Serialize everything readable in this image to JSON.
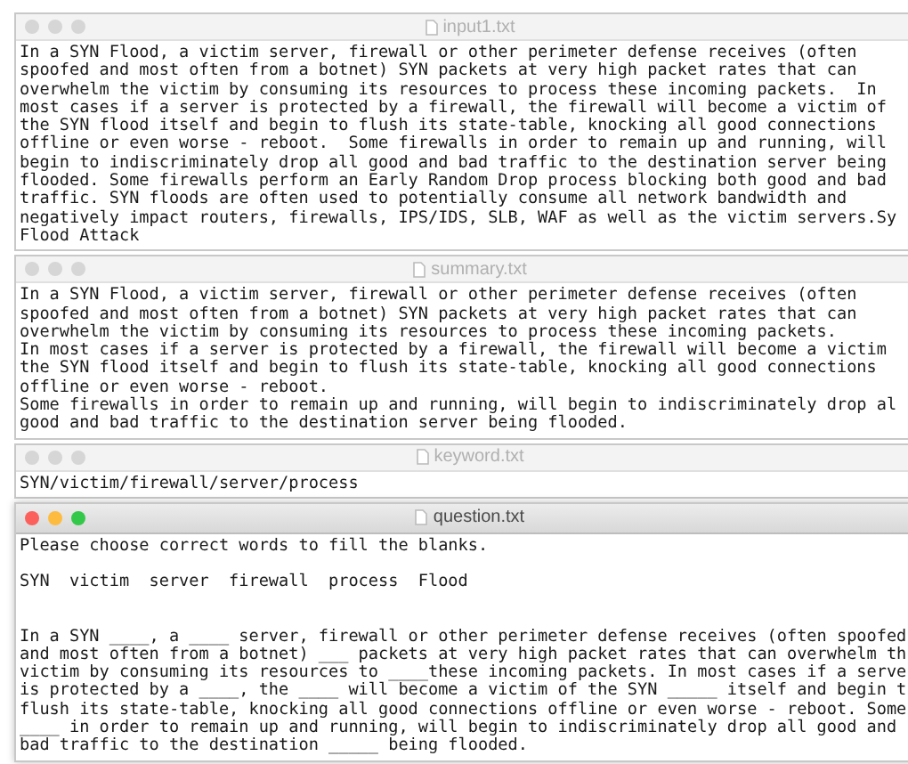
{
  "windows": [
    {
      "title": "input1.txt",
      "active": false,
      "blocks": [
        {
          "kind": "text",
          "lines": [
            "In a SYN Flood, a victim server, firewall or other perimeter defense receives (often",
            "spoofed and most often from a botnet) SYN packets at very high packet rates that can",
            "overwhelm the victim by consuming its resources to process these incoming packets.  In",
            "most cases if a server is protected by a firewall, the firewall will become a victim of",
            "the SYN flood itself and begin to flush its state-table, knocking all good connections",
            "offline or even worse - reboot.  Some firewalls in order to remain up and running, will",
            "begin to indiscriminately drop all good and bad traffic to the destination server being",
            "flooded. Some firewalls perform an Early Random Drop process blocking both good and bad",
            "traffic. SYN floods are often used to potentially consume all network bandwidth and",
            "negatively impact routers, firewalls, IPS/IDS, SLB, WAF as well as the victim servers.Sy",
            "Flood Attack"
          ]
        }
      ]
    },
    {
      "title": "summary.txt",
      "active": false,
      "blocks": [
        {
          "kind": "text",
          "lines": [
            "In a SYN Flood, a victim server, firewall or other perimeter defense receives (often",
            "spoofed and most often from a botnet) SYN packets at very high packet rates that can",
            "overwhelm the victim by consuming its resources to process these incoming packets.",
            "In most cases if a server is protected by a firewall, the firewall will become a victim",
            "the SYN flood itself and begin to flush its state-table, knocking all good connections",
            "offline or even worse - reboot.",
            "Some firewalls in order to remain up and running, will begin to indiscriminately drop al",
            "good and bad traffic to the destination server being flooded."
          ]
        }
      ]
    },
    {
      "title": "keyword.txt",
      "active": false,
      "blocks": [
        {
          "kind": "text",
          "lines": [
            "SYN/victim/firewall/server/process"
          ]
        }
      ]
    },
    {
      "title": "question.txt",
      "active": true,
      "blocks": [
        {
          "kind": "instruction",
          "lines": [
            "Please choose correct words to fill the blanks."
          ]
        },
        {
          "kind": "word_bank",
          "lines": [
            "SYN  victim  server  firewall  process  Flood"
          ]
        },
        {
          "kind": "passage",
          "lines": [
            "In a SYN ____, a ____ server, firewall or other perimeter defense receives (often spoofed",
            "and most often from a botnet) ___ packets at very high packet rates that can overwhelm th",
            "victim by consuming its resources to ____these incoming packets. In most cases if a serve",
            "is protected by a ____, the ____ will become a victim of the SYN _____ itself and begin t",
            "flush its state-table, knocking all good connections offline or even worse - reboot. Some",
            "____ in order to remain up and running, will begin to indiscriminately drop all good and",
            "bad traffic to the destination _____ being flooded."
          ]
        }
      ]
    }
  ]
}
